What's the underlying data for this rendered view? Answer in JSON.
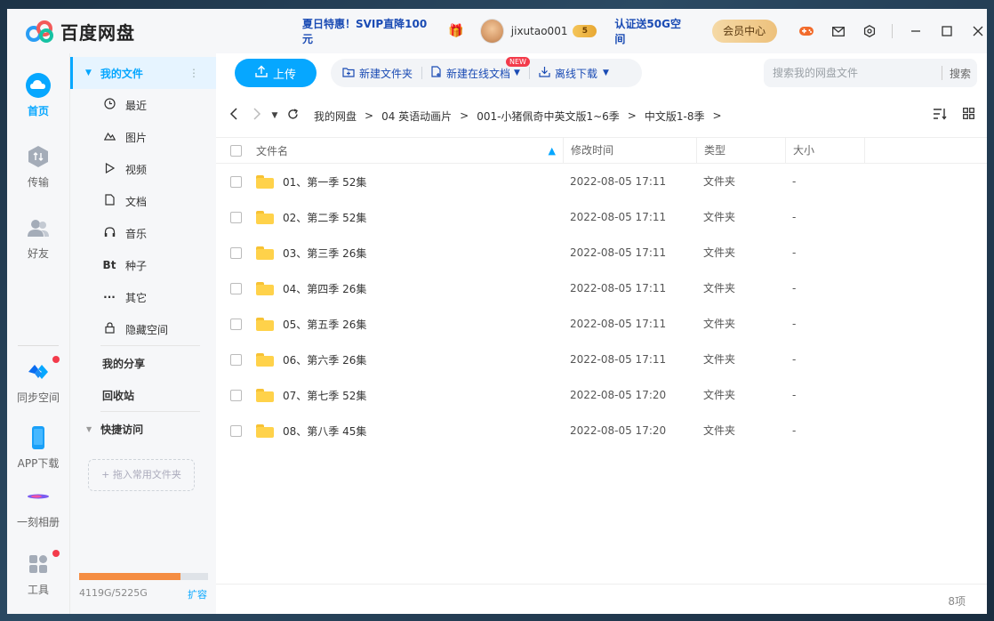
{
  "app": {
    "name": "百度网盘",
    "promo": "夏日特惠！SVIP直降100元",
    "username": "jixutao001",
    "vip_level": "5",
    "verify": "认证送50G空间",
    "member_center": "会员中心"
  },
  "leftnav": {
    "items": [
      {
        "label": "首页",
        "icon": "cloud-home-icon"
      },
      {
        "label": "传输",
        "icon": "transfer-icon"
      },
      {
        "label": "好友",
        "icon": "friends-icon"
      },
      {
        "label": "同步空间",
        "icon": "sync-space-icon"
      },
      {
        "label": "APP下载",
        "icon": "app-download-icon"
      },
      {
        "label": "一刻相册",
        "icon": "album-icon"
      },
      {
        "label": "工具",
        "icon": "tools-icon"
      }
    ]
  },
  "sidebar": {
    "my_files": "我的文件",
    "items": [
      {
        "label": "最近",
        "icon": "clock-icon"
      },
      {
        "label": "图片",
        "icon": "image-icon"
      },
      {
        "label": "视频",
        "icon": "play-icon"
      },
      {
        "label": "文档",
        "icon": "document-icon"
      },
      {
        "label": "音乐",
        "icon": "headphones-icon"
      },
      {
        "label": "种子",
        "icon": "bt-icon"
      },
      {
        "label": "其它",
        "icon": "more-icon"
      },
      {
        "label": "隐藏空间",
        "icon": "lock-icon"
      }
    ],
    "my_share": "我的分享",
    "recycle": "回收站",
    "quick_access": "快捷访问",
    "drop_hint": "+ 拖入常用文件夹",
    "quota_text": "4119G/5225G",
    "quota_fraction": 0.788,
    "expand": "扩容"
  },
  "toolbar": {
    "upload": "上传",
    "new_folder": "新建文件夹",
    "new_doc": "新建在线文档",
    "new_tag": "NEW",
    "offline_download": "离线下载",
    "search_placeholder": "搜索我的网盘文件",
    "search_button": "搜索"
  },
  "breadcrumb": [
    "我的网盘",
    "04 英语动画片",
    "001-小猪佩奇中英文版1~6季",
    "中文版1-8季"
  ],
  "table": {
    "headers": {
      "name": "文件名",
      "time": "修改时间",
      "type": "类型",
      "size": "大小"
    },
    "rows": [
      {
        "name": "01、第一季 52集",
        "time": "2022-08-05 17:11",
        "type": "文件夹",
        "size": "-"
      },
      {
        "name": "02、第二季 52集",
        "time": "2022-08-05 17:11",
        "type": "文件夹",
        "size": "-"
      },
      {
        "name": "03、第三季 26集",
        "time": "2022-08-05 17:11",
        "type": "文件夹",
        "size": "-"
      },
      {
        "name": "04、第四季 26集",
        "time": "2022-08-05 17:11",
        "type": "文件夹",
        "size": "-"
      },
      {
        "name": "05、第五季 26集",
        "time": "2022-08-05 17:11",
        "type": "文件夹",
        "size": "-"
      },
      {
        "name": "06、第六季 26集",
        "time": "2022-08-05 17:11",
        "type": "文件夹",
        "size": "-"
      },
      {
        "name": "07、第七季 52集",
        "time": "2022-08-05 17:20",
        "type": "文件夹",
        "size": "-"
      },
      {
        "name": "08、第八季 45集",
        "time": "2022-08-05 17:20",
        "type": "文件夹",
        "size": "-"
      }
    ]
  },
  "footer": {
    "count": "8项"
  },
  "colors": {
    "accent": "#06a7ff",
    "link": "#1a4bb4",
    "quota": "#f58d42"
  }
}
